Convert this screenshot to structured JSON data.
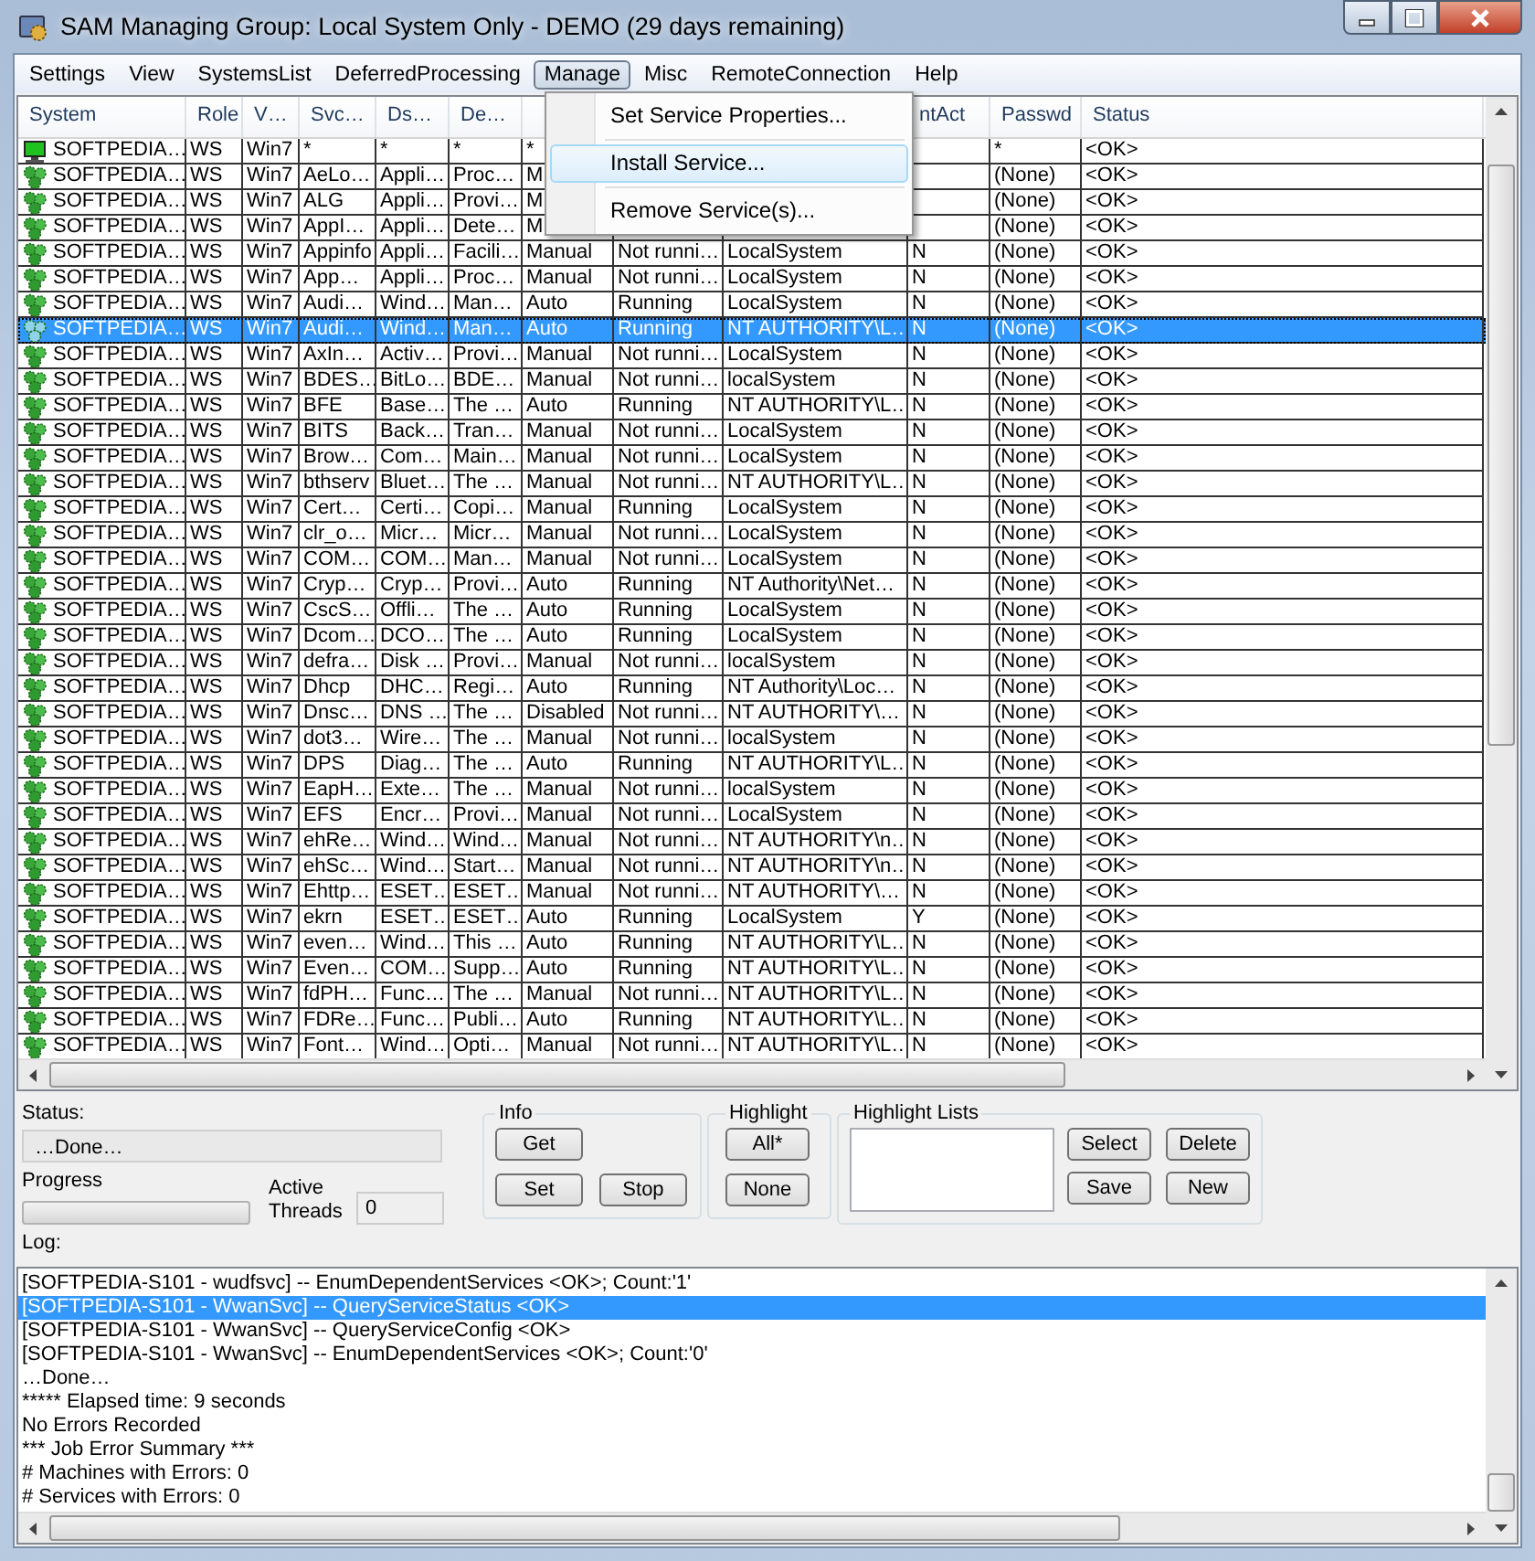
{
  "window": {
    "title": "SAM Managing Group: Local System Only - DEMO (29 days remaining)"
  },
  "menu_bar": [
    {
      "label": "Settings",
      "selected": false
    },
    {
      "label": "View",
      "selected": false
    },
    {
      "label": "SystemsList",
      "selected": false
    },
    {
      "label": "DeferredProcessing",
      "selected": false
    },
    {
      "label": "Manage",
      "selected": true
    },
    {
      "label": "Misc",
      "selected": false
    },
    {
      "label": "RemoteConnection",
      "selected": false
    },
    {
      "label": "Help",
      "selected": false
    }
  ],
  "open_menu": {
    "items": [
      {
        "label": "Set Service Properties...",
        "selected": false
      },
      {
        "label": "Install Service...",
        "selected": true
      },
      {
        "label": "Remove Service(s)...",
        "selected": false
      }
    ]
  },
  "table": {
    "columns": [
      "System",
      "Role",
      "V…",
      "Svc…",
      "Ds…",
      "De…",
      null,
      null,
      null,
      "ntAct",
      "Passwd",
      "Status"
    ],
    "rows": [
      {
        "kind": "computer",
        "selected": false,
        "cells": [
          "SOFTPEDIA…",
          "WS",
          "Win7",
          "*",
          "*",
          "*",
          "*",
          null,
          null,
          null,
          "*",
          "<OK>"
        ]
      },
      {
        "kind": "service",
        "selected": false,
        "cells": [
          "SOFTPEDIA…",
          "WS",
          "Win7",
          "AeLo…",
          "Appli…",
          "Proc…",
          "M",
          null,
          null,
          null,
          "(None)",
          "<OK>"
        ]
      },
      {
        "kind": "service",
        "selected": false,
        "cells": [
          "SOFTPEDIA…",
          "WS",
          "Win7",
          "ALG",
          "Appli…",
          "Provi…",
          "M",
          null,
          null,
          null,
          "(None)",
          "<OK>"
        ]
      },
      {
        "kind": "service",
        "selected": false,
        "cells": [
          "SOFTPEDIA…",
          "WS",
          "Win7",
          "AppI…",
          "Appli…",
          "Dete…",
          "M",
          null,
          null,
          null,
          "(None)",
          "<OK>"
        ]
      },
      {
        "kind": "service",
        "selected": false,
        "cells": [
          "SOFTPEDIA…",
          "WS",
          "Win7",
          "Appinfo",
          "Appli…",
          "Facili…",
          "Manual",
          "Not runni…",
          "LocalSystem",
          "N",
          "(None)",
          "<OK>"
        ]
      },
      {
        "kind": "service",
        "selected": false,
        "cells": [
          "SOFTPEDIA…",
          "WS",
          "Win7",
          "App…",
          "Appli…",
          "Proc…",
          "Manual",
          "Not runni…",
          "LocalSystem",
          "N",
          "(None)",
          "<OK>"
        ]
      },
      {
        "kind": "service",
        "selected": false,
        "cells": [
          "SOFTPEDIA…",
          "WS",
          "Win7",
          "Audi…",
          "Wind…",
          "Man…",
          "Auto",
          "Running",
          "LocalSystem",
          "N",
          "(None)",
          "<OK>"
        ]
      },
      {
        "kind": "service",
        "selected": true,
        "cells": [
          "SOFTPEDIA…",
          "WS",
          "Win7",
          "Audi…",
          "Wind…",
          "Man…",
          "Auto",
          "Running",
          "NT AUTHORITY\\L…",
          "N",
          "(None)",
          "<OK>"
        ]
      },
      {
        "kind": "service",
        "selected": false,
        "cells": [
          "SOFTPEDIA…",
          "WS",
          "Win7",
          "AxIn…",
          "Activ…",
          "Provi…",
          "Manual",
          "Not runni…",
          "LocalSystem",
          "N",
          "(None)",
          "<OK>"
        ]
      },
      {
        "kind": "service",
        "selected": false,
        "cells": [
          "SOFTPEDIA…",
          "WS",
          "Win7",
          "BDES…",
          "BitLo…",
          "BDE…",
          "Manual",
          "Not runni…",
          "localSystem",
          "N",
          "(None)",
          "<OK>"
        ]
      },
      {
        "kind": "service",
        "selected": false,
        "cells": [
          "SOFTPEDIA…",
          "WS",
          "Win7",
          "BFE",
          "Base…",
          "The …",
          "Auto",
          "Running",
          "NT AUTHORITY\\L…",
          "N",
          "(None)",
          "<OK>"
        ]
      },
      {
        "kind": "service",
        "selected": false,
        "cells": [
          "SOFTPEDIA…",
          "WS",
          "Win7",
          "BITS",
          "Back…",
          "Tran…",
          "Manual",
          "Not runni…",
          "LocalSystem",
          "N",
          "(None)",
          "<OK>"
        ]
      },
      {
        "kind": "service",
        "selected": false,
        "cells": [
          "SOFTPEDIA…",
          "WS",
          "Win7",
          "Brow…",
          "Com…",
          "Main…",
          "Manual",
          "Not runni…",
          "LocalSystem",
          "N",
          "(None)",
          "<OK>"
        ]
      },
      {
        "kind": "service",
        "selected": false,
        "cells": [
          "SOFTPEDIA…",
          "WS",
          "Win7",
          "bthserv",
          "Bluet…",
          "The …",
          "Manual",
          "Not runni…",
          "NT AUTHORITY\\L…",
          "N",
          "(None)",
          "<OK>"
        ]
      },
      {
        "kind": "service",
        "selected": false,
        "cells": [
          "SOFTPEDIA…",
          "WS",
          "Win7",
          "Cert…",
          "Certi…",
          "Copi…",
          "Manual",
          "Running",
          "LocalSystem",
          "N",
          "(None)",
          "<OK>"
        ]
      },
      {
        "kind": "service",
        "selected": false,
        "cells": [
          "SOFTPEDIA…",
          "WS",
          "Win7",
          "clr_o…",
          "Micr…",
          "Micr…",
          "Manual",
          "Not runni…",
          "LocalSystem",
          "N",
          "(None)",
          "<OK>"
        ]
      },
      {
        "kind": "service",
        "selected": false,
        "cells": [
          "SOFTPEDIA…",
          "WS",
          "Win7",
          "COM…",
          "COM…",
          "Man…",
          "Manual",
          "Not runni…",
          "LocalSystem",
          "N",
          "(None)",
          "<OK>"
        ]
      },
      {
        "kind": "service",
        "selected": false,
        "cells": [
          "SOFTPEDIA…",
          "WS",
          "Win7",
          "Cryp…",
          "Cryp…",
          "Provi…",
          "Auto",
          "Running",
          "NT Authority\\Net…",
          "N",
          "(None)",
          "<OK>"
        ]
      },
      {
        "kind": "service",
        "selected": false,
        "cells": [
          "SOFTPEDIA…",
          "WS",
          "Win7",
          "CscS…",
          "Offli…",
          "The …",
          "Auto",
          "Running",
          "LocalSystem",
          "N",
          "(None)",
          "<OK>"
        ]
      },
      {
        "kind": "service",
        "selected": false,
        "cells": [
          "SOFTPEDIA…",
          "WS",
          "Win7",
          "Dcom…",
          "DCO…",
          "The …",
          "Auto",
          "Running",
          "LocalSystem",
          "N",
          "(None)",
          "<OK>"
        ]
      },
      {
        "kind": "service",
        "selected": false,
        "cells": [
          "SOFTPEDIA…",
          "WS",
          "Win7",
          "defra…",
          "Disk …",
          "Provi…",
          "Manual",
          "Not runni…",
          "localSystem",
          "N",
          "(None)",
          "<OK>"
        ]
      },
      {
        "kind": "service",
        "selected": false,
        "cells": [
          "SOFTPEDIA…",
          "WS",
          "Win7",
          "Dhcp",
          "DHC…",
          "Regi…",
          "Auto",
          "Running",
          "NT Authority\\Loc…",
          "N",
          "(None)",
          "<OK>"
        ]
      },
      {
        "kind": "service",
        "selected": false,
        "cells": [
          "SOFTPEDIA…",
          "WS",
          "Win7",
          "Dnsc…",
          "DNS …",
          "The …",
          "Disabled",
          "Not runni…",
          "NT AUTHORITY\\…",
          "N",
          "(None)",
          "<OK>"
        ]
      },
      {
        "kind": "service",
        "selected": false,
        "cells": [
          "SOFTPEDIA…",
          "WS",
          "Win7",
          "dot3…",
          "Wire…",
          "The …",
          "Manual",
          "Not runni…",
          "localSystem",
          "N",
          "(None)",
          "<OK>"
        ]
      },
      {
        "kind": "service",
        "selected": false,
        "cells": [
          "SOFTPEDIA…",
          "WS",
          "Win7",
          "DPS",
          "Diag…",
          "The …",
          "Auto",
          "Running",
          "NT AUTHORITY\\L…",
          "N",
          "(None)",
          "<OK>"
        ]
      },
      {
        "kind": "service",
        "selected": false,
        "cells": [
          "SOFTPEDIA…",
          "WS",
          "Win7",
          "EapH…",
          "Exte…",
          "The …",
          "Manual",
          "Not runni…",
          "localSystem",
          "N",
          "(None)",
          "<OK>"
        ]
      },
      {
        "kind": "service",
        "selected": false,
        "cells": [
          "SOFTPEDIA…",
          "WS",
          "Win7",
          "EFS",
          "Encr…",
          "Provi…",
          "Manual",
          "Not runni…",
          "LocalSystem",
          "N",
          "(None)",
          "<OK>"
        ]
      },
      {
        "kind": "service",
        "selected": false,
        "cells": [
          "SOFTPEDIA…",
          "WS",
          "Win7",
          "ehRe…",
          "Wind…",
          "Wind…",
          "Manual",
          "Not runni…",
          "NT AUTHORITY\\n…",
          "N",
          "(None)",
          "<OK>"
        ]
      },
      {
        "kind": "service",
        "selected": false,
        "cells": [
          "SOFTPEDIA…",
          "WS",
          "Win7",
          "ehSc…",
          "Wind…",
          "Start…",
          "Manual",
          "Not runni…",
          "NT AUTHORITY\\n…",
          "N",
          "(None)",
          "<OK>"
        ]
      },
      {
        "kind": "service",
        "selected": false,
        "cells": [
          "SOFTPEDIA…",
          "WS",
          "Win7",
          "Ehttp…",
          "ESET…",
          "ESET…",
          "Manual",
          "Not runni…",
          "NT AUTHORITY\\…",
          "N",
          "(None)",
          "<OK>"
        ]
      },
      {
        "kind": "service",
        "selected": false,
        "cells": [
          "SOFTPEDIA…",
          "WS",
          "Win7",
          "ekrn",
          "ESET…",
          "ESET…",
          "Auto",
          "Running",
          "LocalSystem",
          "Y",
          "(None)",
          "<OK>"
        ]
      },
      {
        "kind": "service",
        "selected": false,
        "cells": [
          "SOFTPEDIA…",
          "WS",
          "Win7",
          "even…",
          "Wind…",
          "This …",
          "Auto",
          "Running",
          "NT AUTHORITY\\L…",
          "N",
          "(None)",
          "<OK>"
        ]
      },
      {
        "kind": "service",
        "selected": false,
        "cells": [
          "SOFTPEDIA…",
          "WS",
          "Win7",
          "Even…",
          "COM…",
          "Supp…",
          "Auto",
          "Running",
          "NT AUTHORITY\\L…",
          "N",
          "(None)",
          "<OK>"
        ]
      },
      {
        "kind": "service",
        "selected": false,
        "cells": [
          "SOFTPEDIA…",
          "WS",
          "Win7",
          "fdPH…",
          "Func…",
          "The …",
          "Manual",
          "Not runni…",
          "NT AUTHORITY\\L…",
          "N",
          "(None)",
          "<OK>"
        ]
      },
      {
        "kind": "service",
        "selected": false,
        "cells": [
          "SOFTPEDIA…",
          "WS",
          "Win7",
          "FDRe…",
          "Func…",
          "Publi…",
          "Auto",
          "Running",
          "NT AUTHORITY\\L…",
          "N",
          "(None)",
          "<OK>"
        ]
      },
      {
        "kind": "service",
        "selected": false,
        "cells": [
          "SOFTPEDIA…",
          "WS",
          "Win7",
          "Font…",
          "Wind…",
          "Opti…",
          "Manual",
          "Not runni…",
          "NT AUTHORITY\\L…",
          "N",
          "(None)",
          "<OK>"
        ]
      }
    ]
  },
  "status_panel": {
    "status_label": "Status:",
    "status_value": "…Done…",
    "progress_label": "Progress",
    "progress": {
      "level": 0
    },
    "threads_label": "Active Threads",
    "threads_value": "0",
    "log_label": "Log:"
  },
  "info_group": {
    "title": "Info",
    "buttons": [
      "Get",
      "Set",
      "Stop"
    ]
  },
  "highlight_group": {
    "title": "Highlight",
    "buttons": [
      "All*",
      "None"
    ]
  },
  "highlight_lists": {
    "title": "Highlight Lists",
    "buttons": [
      "Select",
      "Delete",
      "Save",
      "New"
    ]
  },
  "log": {
    "lines": [
      {
        "text": "[SOFTPEDIA-S101 - wudfsvc] -- EnumDependentServices <OK>; Count:'1'",
        "selected": false
      },
      {
        "text": "[SOFTPEDIA-S101 - WwanSvc] -- QueryServiceStatus <OK>",
        "selected": true
      },
      {
        "text": "[SOFTPEDIA-S101 - WwanSvc] -- QueryServiceConfig <OK>",
        "selected": false
      },
      {
        "text": "[SOFTPEDIA-S101 - WwanSvc] -- EnumDependentServices <OK>; Count:'0'",
        "selected": false
      },
      {
        "text": "…Done…",
        "selected": false
      },
      {
        "text": "***** Elapsed time: 9 seconds",
        "selected": false
      },
      {
        "text": "No Errors Recorded",
        "selected": false
      },
      {
        "text": "*** Job Error Summary ***",
        "selected": false
      },
      {
        "text": "# Machines with Errors: 0",
        "selected": false
      },
      {
        "text": "# Services with Errors: 0",
        "selected": false
      }
    ]
  }
}
